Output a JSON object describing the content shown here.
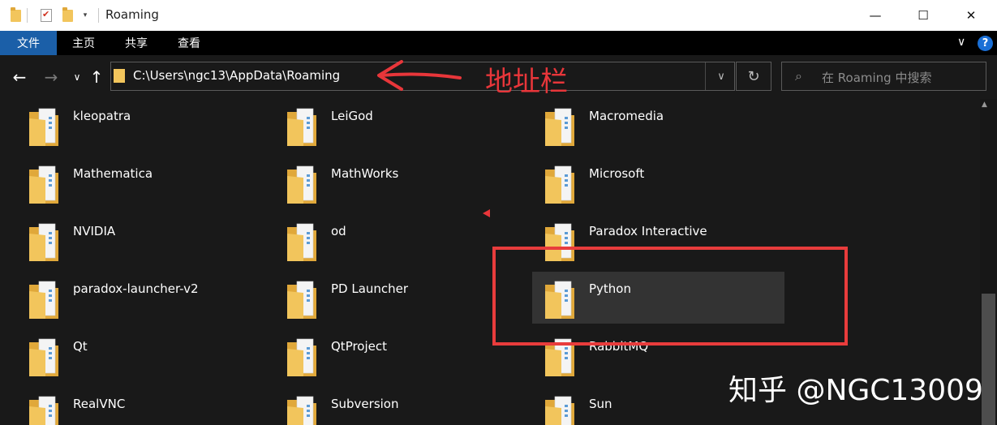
{
  "window": {
    "title": "Roaming",
    "controls": [
      "minimize",
      "maximize",
      "close"
    ]
  },
  "ribbon": {
    "tabs": [
      {
        "label": "文件"
      },
      {
        "label": "主页"
      },
      {
        "label": "共享"
      },
      {
        "label": "查看"
      }
    ],
    "help_label": "?"
  },
  "address_bar": {
    "path": "C:\\Users\\ngc13\\AppData\\Roaming"
  },
  "search": {
    "placeholder": "在 Roaming 中搜索"
  },
  "annotation": {
    "label": "地址栏",
    "color": "#e8363a"
  },
  "folders": [
    {
      "name": "kleopatra"
    },
    {
      "name": "LeiGod"
    },
    {
      "name": "Macromedia"
    },
    {
      "name": "Mathematica"
    },
    {
      "name": "MathWorks"
    },
    {
      "name": "Microsoft"
    },
    {
      "name": "NVIDIA"
    },
    {
      "name": "od"
    },
    {
      "name": "Paradox Interactive"
    },
    {
      "name": "paradox-launcher-v2"
    },
    {
      "name": "PD Launcher"
    },
    {
      "name": "Python",
      "selected": true
    },
    {
      "name": "Qt"
    },
    {
      "name": "QtProject"
    },
    {
      "name": "RabbitMQ"
    },
    {
      "name": "RealVNC"
    },
    {
      "name": "Subversion"
    },
    {
      "name": "Sun"
    }
  ],
  "watermark": "知乎 @NGC13009",
  "colors": {
    "folder": "#f2c55c",
    "accent_tab": "#1b5fa8",
    "highlight": "#e83c3c",
    "selected_bg": "#333333"
  }
}
